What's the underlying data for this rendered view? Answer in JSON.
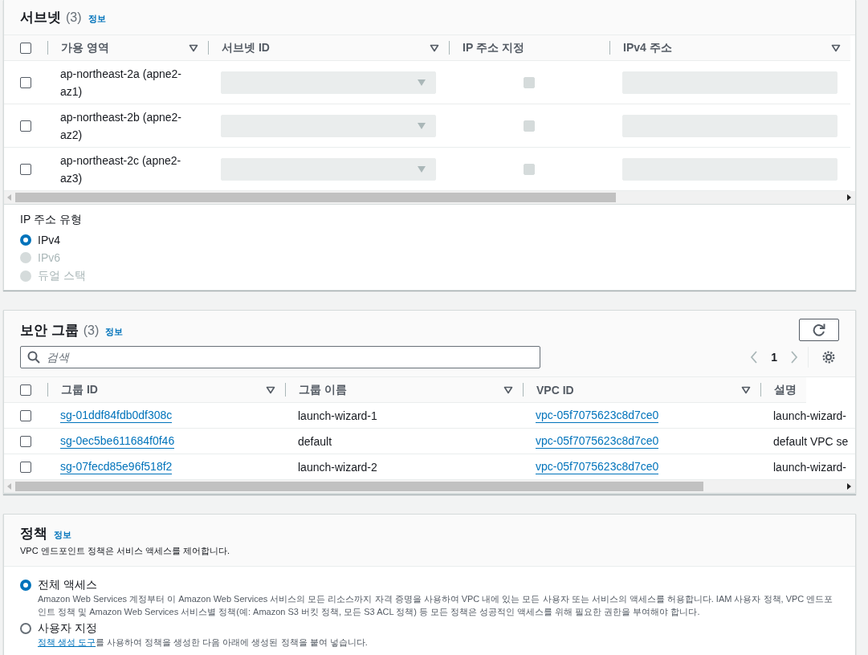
{
  "subnets": {
    "title": "서브넷",
    "count": "(3)",
    "info_link": "정보",
    "all_selected": false,
    "columns": [
      {
        "label": "가용 영역",
        "sortable": true
      },
      {
        "label": "서브넷 ID",
        "sortable": true
      },
      {
        "label": "IP 주소 지정",
        "sortable": false
      },
      {
        "label": "IPv4 주소",
        "sortable": true
      }
    ],
    "rows": [
      {
        "selected": false,
        "zone": "ap-northeast-2a (apne2-az1)",
        "disabled": true,
        "ip_assign_checked": false
      },
      {
        "selected": false,
        "zone": "ap-northeast-2b (apne2-az2)",
        "disabled": true,
        "ip_assign_checked": false
      },
      {
        "selected": false,
        "zone": "ap-northeast-2c (apne2-az3)",
        "disabled": true,
        "ip_assign_checked": false
      }
    ]
  },
  "ip_address_type": {
    "label": "IP 주소 유형",
    "options": [
      {
        "label": "IPv4",
        "selected": true,
        "disabled": false
      },
      {
        "label": "IPv6",
        "selected": false,
        "disabled": true
      },
      {
        "label": "듀얼 스택",
        "selected": false,
        "disabled": true
      }
    ]
  },
  "security_groups": {
    "title": "보안 그룹",
    "count": "(3)",
    "info_link": "정보",
    "all_selected": false,
    "search": {
      "placeholder": "검색"
    },
    "pagination": {
      "page": "1"
    },
    "columns": [
      {
        "label": "그룹 ID",
        "sortable": true
      },
      {
        "label": "그룹 이름",
        "sortable": true
      },
      {
        "label": "VPC ID",
        "sortable": true
      },
      {
        "label": "설명",
        "sortable": false
      }
    ],
    "rows": [
      {
        "selected": false,
        "group_id": "sg-01ddf84fdb0df308c",
        "group_name": "launch-wizard-1",
        "vpc_id": "vpc-05f7075623c8d7ce0",
        "description": "launch-wizard-"
      },
      {
        "selected": false,
        "group_id": "sg-0ec5be611684f0f46",
        "group_name": "default",
        "vpc_id": "vpc-05f7075623c8d7ce0",
        "description": "default VPC se"
      },
      {
        "selected": false,
        "group_id": "sg-07fecd85e96f518f2",
        "group_name": "launch-wizard-2",
        "vpc_id": "vpc-05f7075623c8d7ce0",
        "description": "launch-wizard-"
      }
    ]
  },
  "policy": {
    "title": "정책",
    "info_link": "정보",
    "description": "VPC 엔드포인트 정책은 서비스 액세스를 제어합니다.",
    "options": [
      {
        "label": "전체 액세스",
        "selected": true,
        "description": "Amazon Web Services 계정부터 이 Amazon Web Services 서비스의 모든 리소스까지 자격 증명을 사용하여 VPC 내에 있는 모든 사용자 또는 서비스의 액세스를 허용합니다. IAM 사용자 정책, VPC 엔드포인트 정책 및 Amazon Web Services 서비스별 정책(예: Amazon S3 버킷 정책, 모든 S3 ACL 정책) 등 모든 정책은 성공적인 액세스를 위해 필요한 권한을 부여해야 합니다."
      },
      {
        "label": "사용자 지정",
        "selected": false,
        "description_link": "정책 생성 도구",
        "description": "를 사용하여 정책을 생성한 다음 아래에 생성된 정책을 붙여 넣습니다."
      }
    ]
  }
}
